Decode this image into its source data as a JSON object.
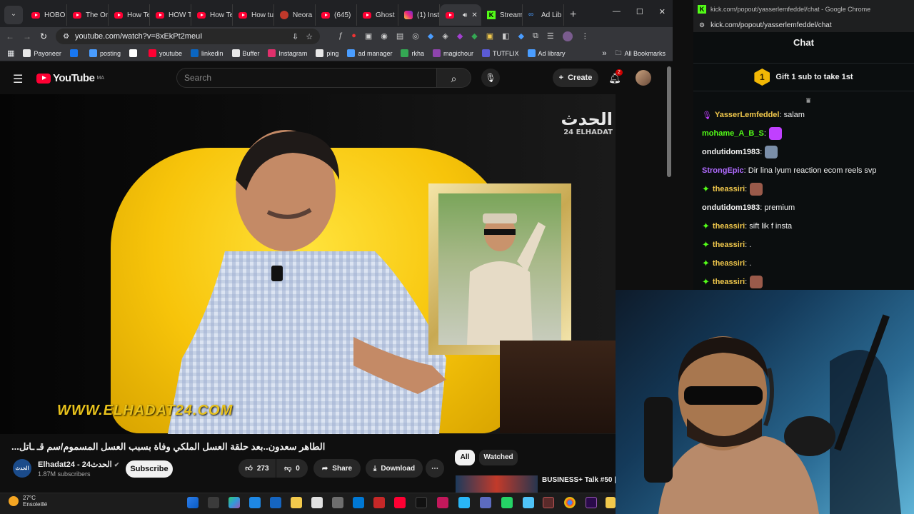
{
  "tabs": [
    {
      "label": "HOBO",
      "icon": "youtube-icon"
    },
    {
      "label": "The Or",
      "icon": "youtube-icon"
    },
    {
      "label": "How Te",
      "icon": "youtube-icon"
    },
    {
      "label": "HOW T",
      "icon": "youtube-icon"
    },
    {
      "label": "How Te",
      "icon": "youtube-icon"
    },
    {
      "label": "How tu",
      "icon": "youtube-icon"
    },
    {
      "label": "Neora",
      "icon": "neora-icon"
    },
    {
      "label": "(645)",
      "icon": "youtube-icon"
    },
    {
      "label": "Ghost",
      "icon": "youtube-icon"
    },
    {
      "label": "(1) Inst",
      "icon": "instagram-icon"
    },
    {
      "label": "",
      "icon": "youtube-icon",
      "active": true
    },
    {
      "label": "Stream",
      "icon": "kick-icon"
    },
    {
      "label": "Ad Lib",
      "icon": "meta-icon"
    }
  ],
  "address_bar": {
    "url": "youtube.com/watch?v=8xEkPt2meuI"
  },
  "bookmarks": [
    {
      "label": "Payoneer",
      "color": "#e8e8e8"
    },
    {
      "label": "",
      "color": "#1877f2"
    },
    {
      "label": "posting",
      "color": "#4a9dff"
    },
    {
      "label": "",
      "color": "#ffffff"
    },
    {
      "label": "youtube",
      "color": "#ff0033"
    },
    {
      "label": "linkedin",
      "color": "#0a66c2"
    },
    {
      "label": "Buffer",
      "color": "#e8e8e8"
    },
    {
      "label": "Instagram",
      "color": "#e1306c"
    },
    {
      "label": "ping",
      "color": "#e8e8e8"
    },
    {
      "label": "ad manager",
      "color": "#4a9dff"
    },
    {
      "label": "rkha",
      "color": "#34a853"
    },
    {
      "label": "magichour",
      "color": "#8e44ad"
    },
    {
      "label": "TUTFLIX",
      "color": "#5b5bd6"
    },
    {
      "label": "Ad library",
      "color": "#4a9dff"
    }
  ],
  "bookmarks_folder": "All Bookmarks",
  "youtube": {
    "logo_text": "YouTube",
    "region": "MA",
    "search_placeholder": "Search",
    "create_label": "Create",
    "notification_count": "2",
    "video_title": "...الطاهر سعدون..بعد حلقة العسل الملكي وفاة بسبب العسل المسموم/سم قـ ـاتل",
    "watermark_url": "WWW.ELHADAT24.COM",
    "watermark_logo": "الحدث",
    "watermark_logo_sub": "24 ELHADAT",
    "channel": {
      "name": "Elhadat24 - الحدث24",
      "subscribers": "1.87M subscribers",
      "avatar_text": "الحدث",
      "subscribe_label": "Subscribe"
    },
    "likes": "273",
    "dislikes": "0",
    "share_label": "Share",
    "download_label": "Download",
    "chips": {
      "all": "All",
      "watched": "Watched"
    },
    "recommendation_title": "BUSINESS+ Talk #50 |"
  },
  "chat_window": {
    "title_bar": "kick.com/popout/yasserlemfeddel/chat - Google Chrome",
    "url": "kick.com/popout/yasserlemfeddel/chat",
    "heading": "Chat",
    "gift_badge": "1",
    "gift_text": "Gift 1 sub to take 1st",
    "messages": [
      {
        "user": "YasserLemfeddel",
        "color": "#f2c94c",
        "badge": "mic-icon",
        "text": ": salam"
      },
      {
        "user": "mohame_A_B_S",
        "color": "#53fc18",
        "badge": "",
        "text": ":",
        "emote": "#c040ff"
      },
      {
        "user": "ondutidom1983",
        "color": "#f1f1f1",
        "badge": "",
        "text": ":",
        "emote": "#7a8ea8"
      },
      {
        "user": "StrongEpic",
        "color": "#b06bff",
        "badge": "",
        "text": ": Dir lina lyum reaction ecom reels svp"
      },
      {
        "user": "theassiri",
        "color": "#f2c94c",
        "badge": "sparkle-icon",
        "text": ":",
        "emote": "#9a5a4a"
      },
      {
        "user": "ondutidom1983",
        "color": "#f1f1f1",
        "badge": "",
        "text": ": premium"
      },
      {
        "user": "theassiri",
        "color": "#f2c94c",
        "badge": "sparkle-icon",
        "text": ": sift lik f insta"
      },
      {
        "user": "theassiri",
        "color": "#f2c94c",
        "badge": "sparkle-icon",
        "text": ": ."
      },
      {
        "user": "theassiri",
        "color": "#f2c94c",
        "badge": "sparkle-icon",
        "text": ": ."
      },
      {
        "user": "theassiri",
        "color": "#f2c94c",
        "badge": "sparkle-icon",
        "text": ":",
        "emote": "#9a5a4a"
      }
    ]
  },
  "taskbar": {
    "temperature": "27°C",
    "weather": "Ensoleillé"
  }
}
